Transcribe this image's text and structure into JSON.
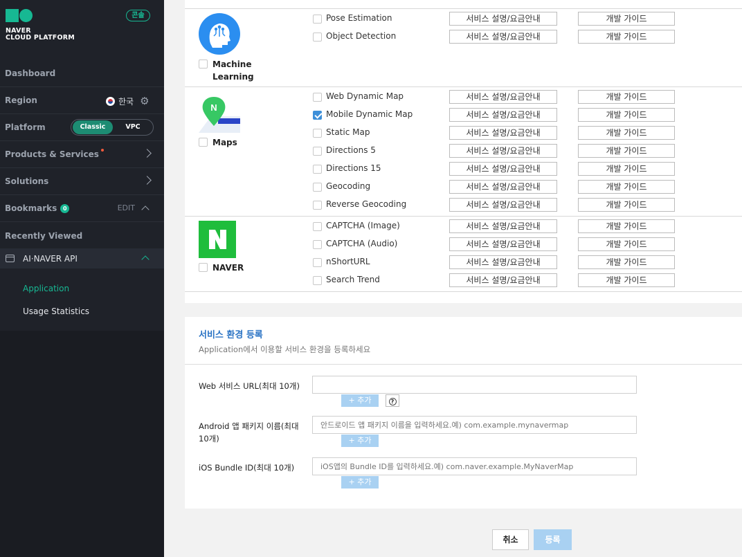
{
  "sidebar": {
    "brand_line1": "NAVER",
    "brand_line2": "CLOUD PLATFORM",
    "console_badge": "콘솔",
    "dashboard": "Dashboard",
    "region_label": "Region",
    "region_value": "한국",
    "platform_label": "Platform",
    "platform_options": [
      "Classic",
      "VPC"
    ],
    "products": "Products & Services",
    "solutions": "Solutions",
    "bookmarks": "Bookmarks",
    "bookmarks_count": "0",
    "bookmarks_edit": "EDIT",
    "recently_viewed": "Recently Viewed",
    "api_section": "AI·NAVER API",
    "sub_items": [
      "Application",
      "Usage Statistics"
    ],
    "accent": "#17b893"
  },
  "groups": [
    {
      "label": "Machine Learning",
      "services": [
        {
          "name": "Pose Estimation",
          "checked": false
        },
        {
          "name": "Object Detection",
          "checked": false
        }
      ]
    },
    {
      "label": "Maps",
      "services": [
        {
          "name": "Web Dynamic Map",
          "checked": false
        },
        {
          "name": "Mobile Dynamic Map",
          "checked": true
        },
        {
          "name": "Static Map",
          "checked": false
        },
        {
          "name": "Directions 5",
          "checked": false
        },
        {
          "name": "Directions 15",
          "checked": false
        },
        {
          "name": "Geocoding",
          "checked": false
        },
        {
          "name": "Reverse Geocoding",
          "checked": false
        }
      ]
    },
    {
      "label": "NAVER",
      "services": [
        {
          "name": "CAPTCHA (Image)",
          "checked": false
        },
        {
          "name": "CAPTCHA (Audio)",
          "checked": false
        },
        {
          "name": "nShortURL",
          "checked": false
        },
        {
          "name": "Search Trend",
          "checked": false
        }
      ]
    }
  ],
  "buttons": {
    "desc": "서비스 설명/요금안내",
    "guide": "개발 가이드"
  },
  "form": {
    "title": "서비스 환경 등록",
    "subtitle": "Application에서 이용할 서비스 환경을 등록하세요",
    "web_label": "Web 서비스 URL(최대 10개)",
    "web_placeholder": "",
    "android_label_1": "Android 앱 패키지 이름(최대",
    "android_label_2": "10개)",
    "android_placeholder": "안드로이드 앱 패키지 이름을 입력하세요.예) com.example.mynavermap",
    "ios_label": "iOS Bundle ID(최대 10개)",
    "ios_placeholder": "iOS앱의 Bundle ID를 입력하세요.예) com.naver.example.MyNaverMap",
    "add_label": "+ 추가",
    "help": "?"
  },
  "footer": {
    "cancel": "취소",
    "submit": "등록"
  }
}
